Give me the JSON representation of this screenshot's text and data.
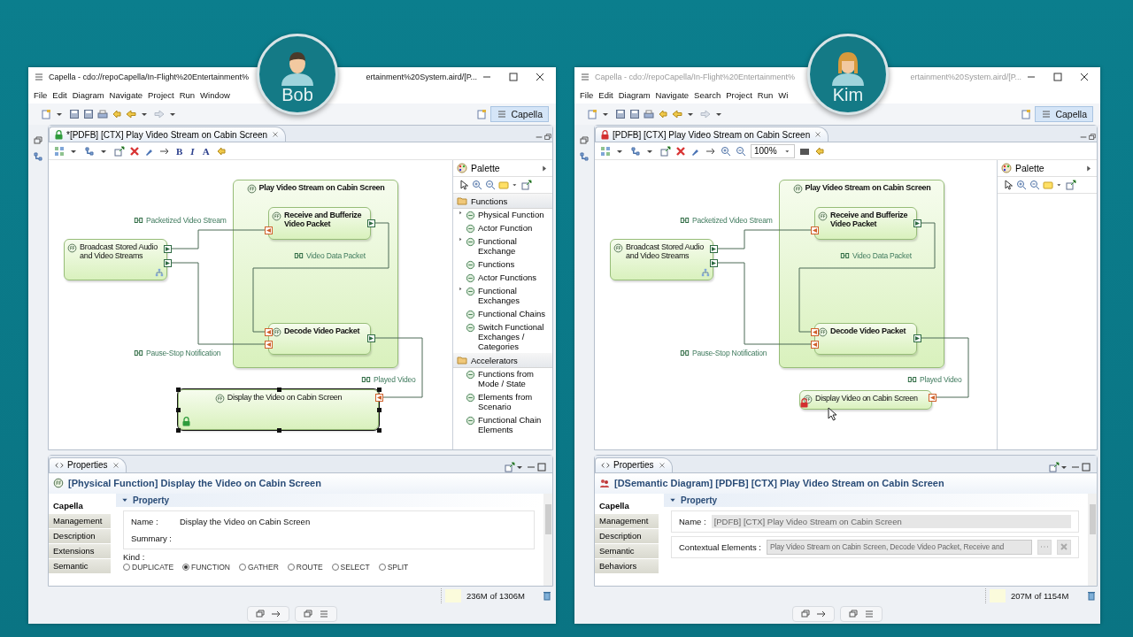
{
  "windows": [
    {
      "user": {
        "name": "Bob",
        "kind": "man"
      },
      "active": true,
      "title_start": "Capella - cdo://repoCapella/In-Flight%20Entertainment%",
      "title_end": "ertainment%20System.aird/[P...",
      "menu": [
        "File",
        "Edit",
        "Diagram",
        "Navigate",
        "Project",
        "Run",
        "Window"
      ],
      "perspective": "Capella",
      "editor_tab": {
        "label": "*[PDFB] [CTX] Play Video Stream on Cabin Screen",
        "locked": true,
        "locked_by_other": false
      },
      "diagram_toolbar": {
        "text_buttons": [
          "B",
          "I",
          "A"
        ]
      },
      "diagram": {
        "nodes": [
          {
            "kind": "container",
            "label": "Play Video Stream on Cabin Screen",
            "selected": false,
            "locked": false
          },
          {
            "kind": "internal",
            "label": "Receive and Bufferize Video Packet",
            "selected": false,
            "locked": false
          },
          {
            "kind": "internal",
            "label": "Decode Video Packet",
            "selected": false,
            "locked": false
          },
          {
            "kind": "external",
            "label": "Broadcast Stored Audio and Video Streams",
            "selected": false,
            "locked": false
          },
          {
            "kind": "external",
            "label": "Display the Video on Cabin Screen",
            "selected": true,
            "locked": true,
            "locked_by_other": false
          }
        ],
        "exchanges": [
          {
            "label": "Packetized Video Stream"
          },
          {
            "label": "Video Data Packet"
          },
          {
            "label": "Pause-Stop Notification"
          },
          {
            "label": "Played Video"
          }
        ]
      },
      "palette": {
        "title": "Palette",
        "sections": [
          {
            "title": "Functions",
            "items": [
              {
                "label": "Physical Function",
                "expandable": true
              },
              {
                "label": "Actor Function",
                "expandable": false
              },
              {
                "label": "Functional Exchange",
                "expandable": true
              },
              {
                "label": "Functions",
                "expandable": false
              },
              {
                "label": "Actor Functions",
                "expandable": false
              },
              {
                "label": "Functional Exchanges",
                "expandable": true
              },
              {
                "label": "Functional Chains",
                "expandable": false
              },
              {
                "label": "Switch Functional Exchanges / Categories",
                "expandable": false
              }
            ]
          },
          {
            "title": "Accelerators",
            "items": [
              {
                "label": "Functions from Mode / State",
                "expandable": false
              },
              {
                "label": "Elements from Scenario",
                "expandable": false
              },
              {
                "label": "Functional Chain Elements",
                "expandable": false
              }
            ]
          }
        ]
      },
      "properties": {
        "tab": "Properties",
        "title": "[Physical Function] Display the Video on Cabin Screen",
        "kind": "function",
        "tabs": [
          {
            "label": "Capella",
            "selected": true
          },
          {
            "label": "Management",
            "selected": false
          },
          {
            "label": "Description",
            "selected": false
          },
          {
            "label": "Extensions",
            "selected": false
          },
          {
            "label": "Semantic",
            "selected": false
          }
        ],
        "section": "Property",
        "fields": [
          {
            "kind": "text",
            "label": "Name :",
            "value": "Display the Video on Cabin Screen",
            "disabled": false
          },
          {
            "kind": "text",
            "label": "Summary :"
          }
        ],
        "kind_group": {
          "label": "Kind :",
          "options": [
            {
              "label": "DUPLICATE",
              "selected": false
            },
            {
              "label": "FUNCTION",
              "selected": true
            },
            {
              "label": "GATHER",
              "selected": false
            },
            {
              "label": "ROUTE",
              "selected": false
            },
            {
              "label": "SELECT",
              "selected": false
            },
            {
              "label": "SPLIT",
              "selected": false
            }
          ]
        }
      },
      "memory": "236M of 1306M"
    },
    {
      "user": {
        "name": "Kim",
        "kind": "woman"
      },
      "active": false,
      "title_start": "Capella - cdo://repoCapella/In-Flight%20Entertainment%",
      "title_end": "ertainment%20System.aird/[P...",
      "menu": [
        "File",
        "Edit",
        "Diagram",
        "Navigate",
        "Search",
        "Project",
        "Run",
        "Wi"
      ],
      "perspective": "Capella",
      "editor_tab": {
        "label": "[PDFB] [CTX] Play Video Stream on Cabin Screen",
        "locked": true,
        "locked_by_other": true
      },
      "diagram_toolbar": {
        "zoom": "100%"
      },
      "diagram": {
        "nodes": [
          {
            "kind": "container",
            "label": "Play Video Stream on Cabin Screen",
            "selected": false,
            "locked": false
          },
          {
            "kind": "internal",
            "label": "Receive and Bufferize Video Packet",
            "selected": false,
            "locked": false
          },
          {
            "kind": "internal",
            "label": "Decode Video Packet",
            "selected": false,
            "locked": false
          },
          {
            "kind": "external",
            "label": "Broadcast Stored Audio and Video Streams",
            "selected": false,
            "locked": false
          },
          {
            "kind": "external",
            "label": "Display Video on Cabin Screen",
            "selected": false,
            "locked": true,
            "locked_by_other": true
          }
        ],
        "exchanges": [
          {
            "label": "Packetized Video Stream"
          },
          {
            "label": "Video Data Packet"
          },
          {
            "label": "Pause-Stop Notification"
          },
          {
            "label": "Played Video"
          }
        ]
      },
      "palette": {
        "title": "Palette"
      },
      "properties": {
        "tab": "Properties",
        "title": "[DSemantic Diagram] [PDFB] [CTX] Play Video Stream on Cabin Screen",
        "kind": "diagram",
        "tabs": [
          {
            "label": "Capella",
            "selected": true
          },
          {
            "label": "Management",
            "selected": false
          },
          {
            "label": "Description",
            "selected": false
          },
          {
            "label": "Semantic",
            "selected": false
          },
          {
            "label": "Behaviors",
            "selected": false
          }
        ],
        "section": "Property",
        "fields": [
          {
            "kind": "text",
            "label": "Name :",
            "value": "[PDFB] [CTX] Play Video Stream on Cabin Screen",
            "disabled": true
          },
          {
            "kind": "list",
            "label": "Contextual Elements :",
            "value": "Play Video Stream on Cabin Screen, Decode Video Packet, Receive and",
            "disabled": true
          }
        ]
      },
      "memory": "207M of 1154M"
    }
  ]
}
